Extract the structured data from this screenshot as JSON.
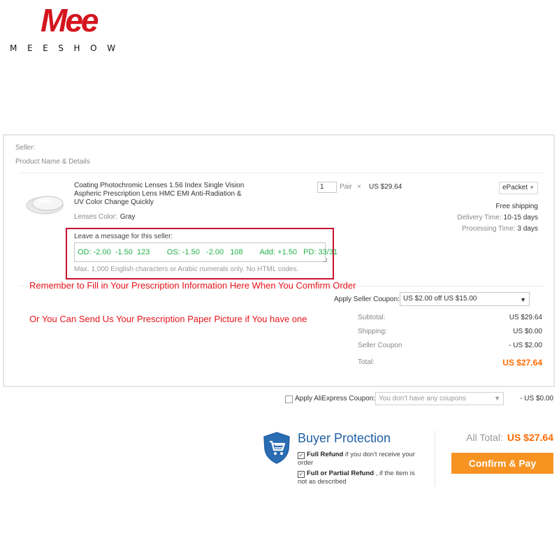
{
  "brand": {
    "logo_mark": "Mee",
    "wordmark": "MEESHOW"
  },
  "order": {
    "seller_label": "Seller:",
    "product_header": "Product Name & Details",
    "product": {
      "title": "Coating Photochromic Lenses 1.56 Index Single Vision Aspheric Prescription Lens HMC EMI Anti-Radiation & UV Color Change Quickly",
      "color_label": "Lenses Color:",
      "color_value": "Gray",
      "quantity": "1",
      "unit": "Pair",
      "times": "×",
      "price": "US $29.64"
    },
    "shipping": {
      "method": "ePacket",
      "free_shipping": "Free shipping",
      "delivery_label": "Delivery Time:",
      "delivery_value": "10-15 days",
      "processing_label": "Processing Time:",
      "processing_value": "3 days"
    },
    "message": {
      "label": "Leave a message for this seller:",
      "value": "OD: -2.00  -1.50  123        OS: -1.50   -2.00   108        Add: +1.50   PD: 33/31",
      "hint": "Max. 1,000 English characters or Arabic numerals only. No HTML codes."
    },
    "notes": {
      "line1": "Remember to Fill in Your Prescription Information Here When You Comfirm Order",
      "line2": "Or You Can Send Us Your Prescription Paper Picture if You have one"
    },
    "seller_coupon": {
      "label": "Apply Seller Coupon:",
      "selected": "US $2.00 off US $15.00"
    },
    "summary": {
      "subtotal_label": "Subtotal:",
      "subtotal": "US $29.64",
      "shipping_label": "Shipping:",
      "shipping": "US $0.00",
      "coupon_label": "Seller Coupon",
      "coupon": "- US $2.00",
      "total_label": "Total:",
      "total": "US $27.64"
    }
  },
  "aliexpress_coupon": {
    "label": "Apply AliExpress Coupon:",
    "placeholder": "You don't have any coupons",
    "amount": "- US $0.00"
  },
  "protection": {
    "title": "Buyer Protection",
    "item1_bold": "Full Refund",
    "item1_rest": " if you don't receive your order",
    "item2_bold": "Full or Partial Refund",
    "item2_rest": " , if the item is not as described"
  },
  "checkout": {
    "all_total_label": "All Total:",
    "all_total": "US $27.64",
    "pay_button": "Confirm & Pay"
  },
  "colors": {
    "accent_orange": "#ff6a00",
    "button_orange": "#f79321",
    "alert_red": "#e8141b",
    "prescription_green": "#22b14c",
    "protection_blue": "#1f5fa4"
  }
}
